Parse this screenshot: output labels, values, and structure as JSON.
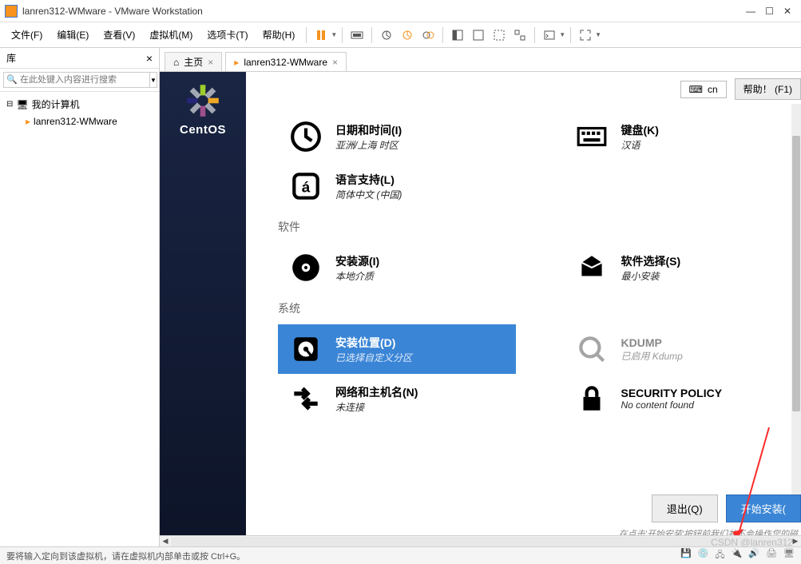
{
  "titlebar": {
    "title": "lanren312-WMware - VMware Workstation"
  },
  "menu": [
    "文件(F)",
    "编辑(E)",
    "查看(V)",
    "虚拟机(M)",
    "选项卡(T)",
    "帮助(H)"
  ],
  "sidebar": {
    "title": "库",
    "search_placeholder": "在此处键入内容进行搜索",
    "root": "我的计算机",
    "child": "lanren312-WMware"
  },
  "tabs": {
    "home": "主页",
    "vm": "lanren312-WMware"
  },
  "centos": {
    "name": "CentOS"
  },
  "installer": {
    "lang_code": "cn",
    "help": "帮助！ (F1)",
    "sections": {
      "software": "软件",
      "system": "系统"
    },
    "opts": {
      "datetime": {
        "t": "日期和时间(I)",
        "s": "亚洲/上海 时区"
      },
      "keyboard": {
        "t": "键盘(K)",
        "s": "汉语"
      },
      "lang": {
        "t": "语言支持(L)",
        "s": "简体中文 (中国)"
      },
      "source": {
        "t": "安装源(I)",
        "s": "本地介质"
      },
      "swsel": {
        "t": "软件选择(S)",
        "s": "最小安装"
      },
      "dest": {
        "t": "安装位置(D)",
        "s": "已选择自定义分区"
      },
      "kdump": {
        "t": "KDUMP",
        "s": "已启用 Kdump"
      },
      "net": {
        "t": "网络和主机名(N)",
        "s": "未连接"
      },
      "sec": {
        "t": "SECURITY POLICY",
        "s": "No content found"
      }
    },
    "quit": "退出(Q)",
    "begin": "开始安装(",
    "hint": "在点击'开始安装'按钮前我们并不会操作您的磁"
  },
  "status": {
    "text": "要将输入定向到该虚拟机，请在虚拟机内部单击或按 Ctrl+G。"
  },
  "watermark": "CSDN @lanren312"
}
